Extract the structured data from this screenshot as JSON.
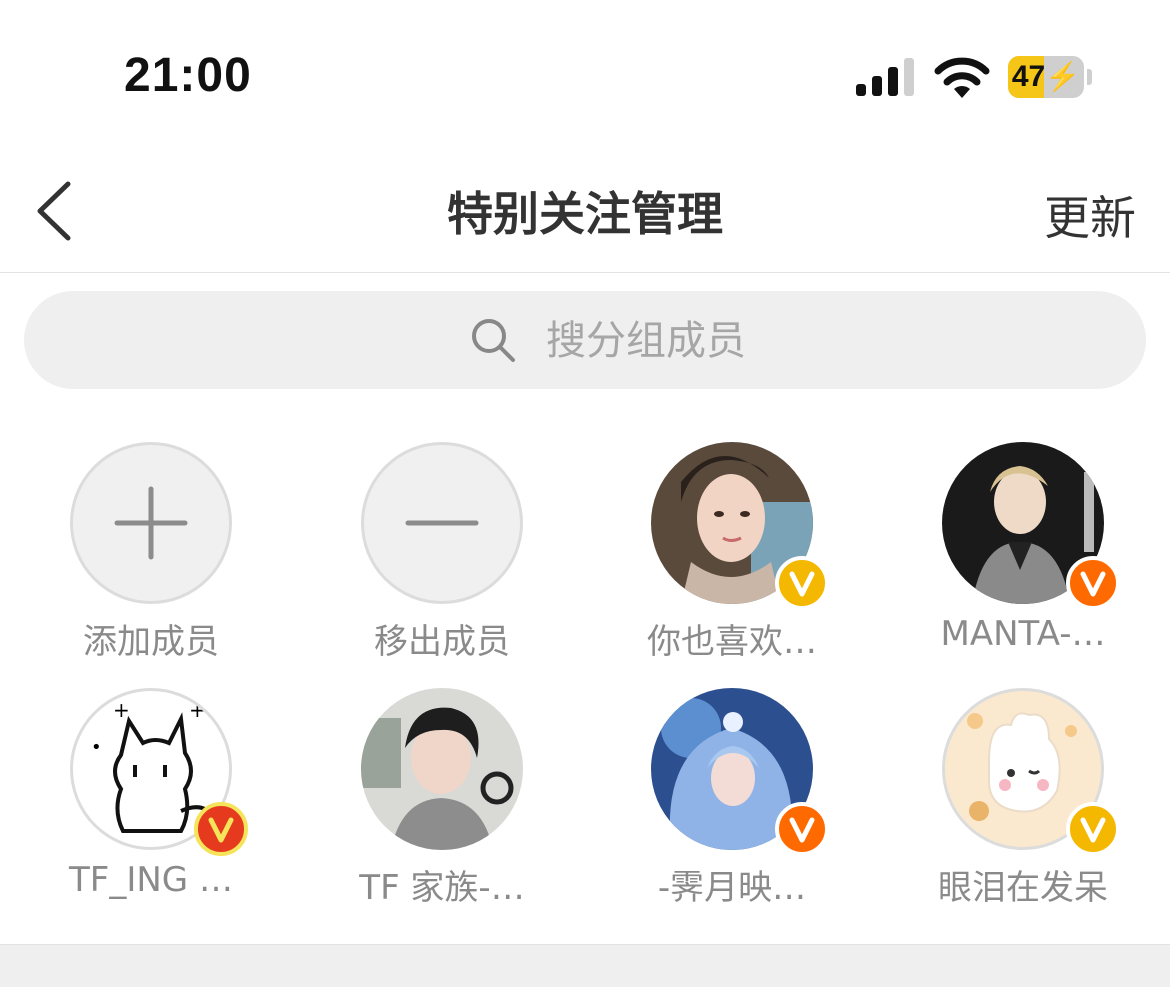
{
  "status_bar": {
    "time": "21:00",
    "battery_percent": "47",
    "battery_level": 0.47
  },
  "nav": {
    "title": "特别关注管理",
    "action_label": "更新",
    "back_icon": "chevron-left-icon"
  },
  "search": {
    "placeholder": "搜分组成员",
    "value": ""
  },
  "actions": [
    {
      "label": "添加成员",
      "icon": "plus-icon"
    },
    {
      "label": "移出成员",
      "icon": "minus-icon"
    }
  ],
  "members": [
    {
      "name": "你也喜欢…",
      "badge_color": "#f5b800"
    },
    {
      "name": "MANTA-…",
      "badge_color": "#ff6a00"
    },
    {
      "name": "TF_ING …",
      "badge_color": "#e63a1e"
    },
    {
      "name": "TF 家族-…",
      "badge_color": null
    },
    {
      "name": "-霁月映…",
      "badge_color": "#ff6a00"
    },
    {
      "name": "眼泪在发呆",
      "badge_color": "#f5b800"
    }
  ],
  "colors": {
    "accent_gold": "#f5b800",
    "accent_orange": "#ff6a00",
    "muted_text": "#8a8a8a"
  }
}
